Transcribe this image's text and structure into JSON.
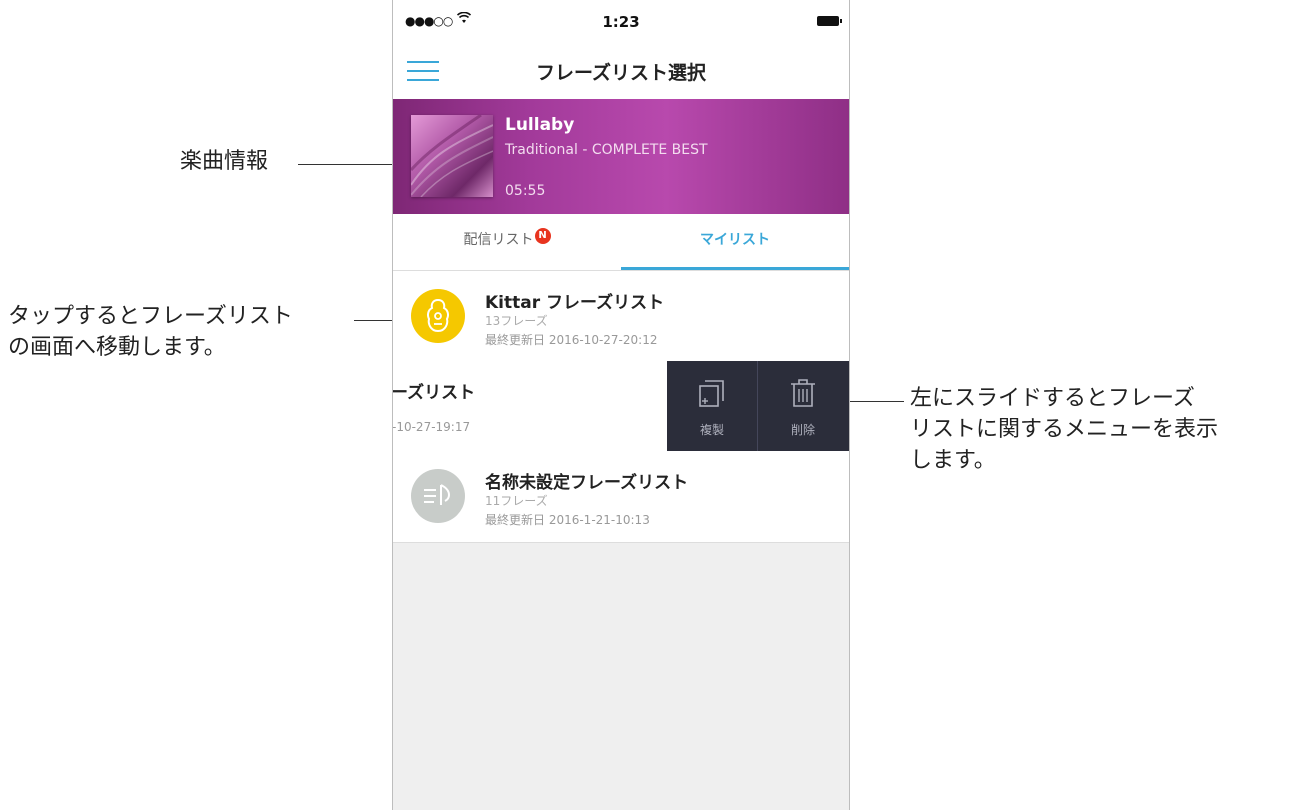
{
  "annotations": {
    "song_info": "楽曲情報",
    "tap_line1": "タップするとフレーズリスト",
    "tap_line2": "の画面へ移動します。",
    "slide_line1": "左にスライドするとフレーズ",
    "slide_line2": "リストに関するメニューを表示",
    "slide_line3": "します。"
  },
  "status_bar": {
    "signal": "●●●○○",
    "wifi": "wifi-icon",
    "time": "1:23",
    "battery": "battery-icon"
  },
  "nav": {
    "title": "フレーズリスト選択",
    "menu_icon": "hamburger-menu-icon"
  },
  "song": {
    "title": "Lullaby",
    "artist": "Traditional - COMPLETE BEST",
    "duration": "05:55"
  },
  "tabs": [
    {
      "label": "配信リスト",
      "badge": "N",
      "active": false
    },
    {
      "label": "マイリスト",
      "active": true
    }
  ],
  "lists": [
    {
      "title": "Kittar フレーズリスト",
      "count": "13フレーズ",
      "updated": "最終更新日 2016-10-27-20:12",
      "icon": "guitar-icon",
      "icon_color": "#f5c800"
    },
    {
      "title_visible": "ーズリスト",
      "updated_visible": "-10-27-19:17",
      "swiped": true
    },
    {
      "title": "名称未設定フレーズリスト",
      "count": "11フレーズ",
      "updated": "最終更新日 2016-1-21-10:13",
      "icon": "music-list-icon",
      "icon_color": "#c8ccc9"
    }
  ],
  "swipe_actions": [
    {
      "label": "複製",
      "icon": "copy-icon"
    },
    {
      "label": "削除",
      "icon": "trash-icon"
    }
  ],
  "colors": {
    "accent": "#3aa7d8",
    "badge": "#e8341f",
    "action_bg": "#2b2d3a"
  }
}
